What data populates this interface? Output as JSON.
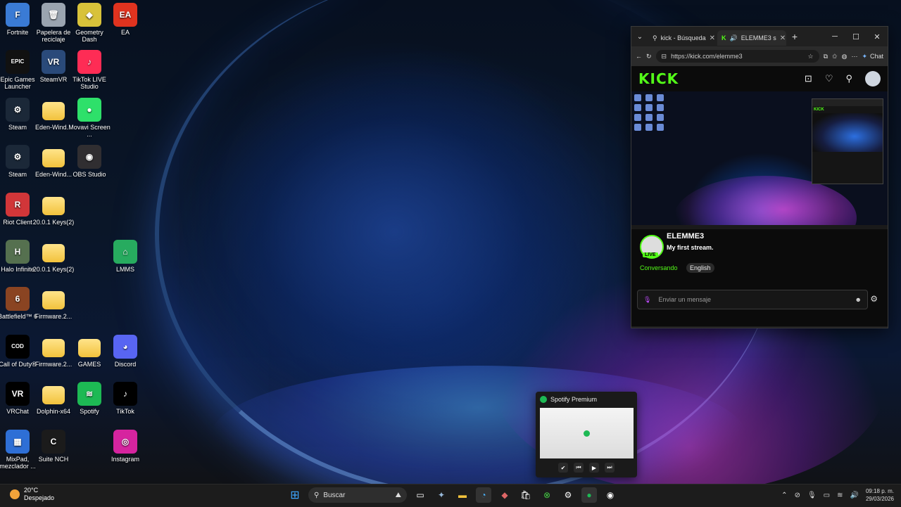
{
  "desktop": {
    "icons": [
      {
        "label": "Fortnite",
        "color": "#3a7bd5",
        "glyph": "F"
      },
      {
        "label": "Papelera de reciclaje",
        "color": "#9aa4b0",
        "glyph": "🗑"
      },
      {
        "label": "Geometry Dash",
        "color": "#d8c23a",
        "glyph": "◆"
      },
      {
        "label": "EA",
        "color": "#e0331f",
        "glyph": "EA"
      },
      {
        "label": "Epic Games Launcher",
        "color": "#111111",
        "glyph": "EPIC"
      },
      {
        "label": "SteamVR",
        "color": "#2a4a7a",
        "glyph": "VR"
      },
      {
        "label": "TikTok LIVE Studio",
        "color": "#fe2c55",
        "glyph": "♪"
      },
      {
        "label": "Steam",
        "color": "#1b2838",
        "glyph": "⚙"
      },
      {
        "label": "Eden-Wind...",
        "color": "folder",
        "glyph": ""
      },
      {
        "label": "Movavi Screen ...",
        "color": "#2ee06a",
        "glyph": "●"
      },
      {
        "label": "Steam",
        "color": "#1b2838",
        "glyph": "⚙"
      },
      {
        "label": "Eden-Wind...",
        "color": "folder",
        "glyph": ""
      },
      {
        "label": "OBS Studio",
        "color": "#302e31",
        "glyph": "◉"
      },
      {
        "label": "Riot Client",
        "color": "#d13639",
        "glyph": "R"
      },
      {
        "label": "20.0.1 Keys(2)",
        "color": "folder",
        "glyph": ""
      },
      {
        "label": "Halo Infinite",
        "color": "#55704f",
        "glyph": "H"
      },
      {
        "label": "20.0.1 Keys(2)",
        "color": "folder",
        "glyph": ""
      },
      {
        "label": "LMMS",
        "color": "#27ab5f",
        "glyph": "⌂"
      },
      {
        "label": "Battlefield™ 6",
        "color": "#8a4422",
        "glyph": "6"
      },
      {
        "label": "Firmware.2...",
        "color": "folder",
        "glyph": ""
      },
      {
        "label": "Call of Duty®",
        "color": "#000000",
        "glyph": "COD"
      },
      {
        "label": "Firmware.2...",
        "color": "folder",
        "glyph": ""
      },
      {
        "label": "GAMES",
        "color": "folder",
        "glyph": ""
      },
      {
        "label": "Discord",
        "color": "#5865f2",
        "glyph": "◕"
      },
      {
        "label": "VRChat",
        "color": "#000000",
        "glyph": "VR"
      },
      {
        "label": "Dolphin-x64",
        "color": "folder",
        "glyph": ""
      },
      {
        "label": "Spotify",
        "color": "#1db954",
        "glyph": "≋"
      },
      {
        "label": "TikTok",
        "color": "#000000",
        "glyph": "♪"
      },
      {
        "label": "MixPad, mezclador ...",
        "color": "#2e6fd6",
        "glyph": "▦"
      },
      {
        "label": "Suite NCH",
        "color": "#1b1b1b",
        "glyph": "C"
      },
      {
        "label": "Instagram",
        "color": "#d6249f",
        "glyph": "◎"
      }
    ]
  },
  "browser": {
    "tabs": [
      {
        "label": "kick - Búsqueda",
        "icon": "search-icon"
      },
      {
        "label": "ELEMME3 s",
        "icon": "kick-icon"
      }
    ],
    "url": "https://kick.com/elemme3",
    "chat_label": "Chat",
    "kick": {
      "logo": "KICK",
      "streamer": "ELEMME3",
      "stream_title": "My first stream.",
      "live_badge": "LIVE",
      "category": "Conversando",
      "language": "English",
      "message_placeholder": "Enviar un mensaje"
    }
  },
  "spotify": {
    "title": "Spotify Premium"
  },
  "taskbar": {
    "weather_temp": "20°C",
    "weather_desc": "Despejado",
    "search_placeholder": "Buscar",
    "time": "09:18 p. m.",
    "date": "29/03/2026"
  }
}
